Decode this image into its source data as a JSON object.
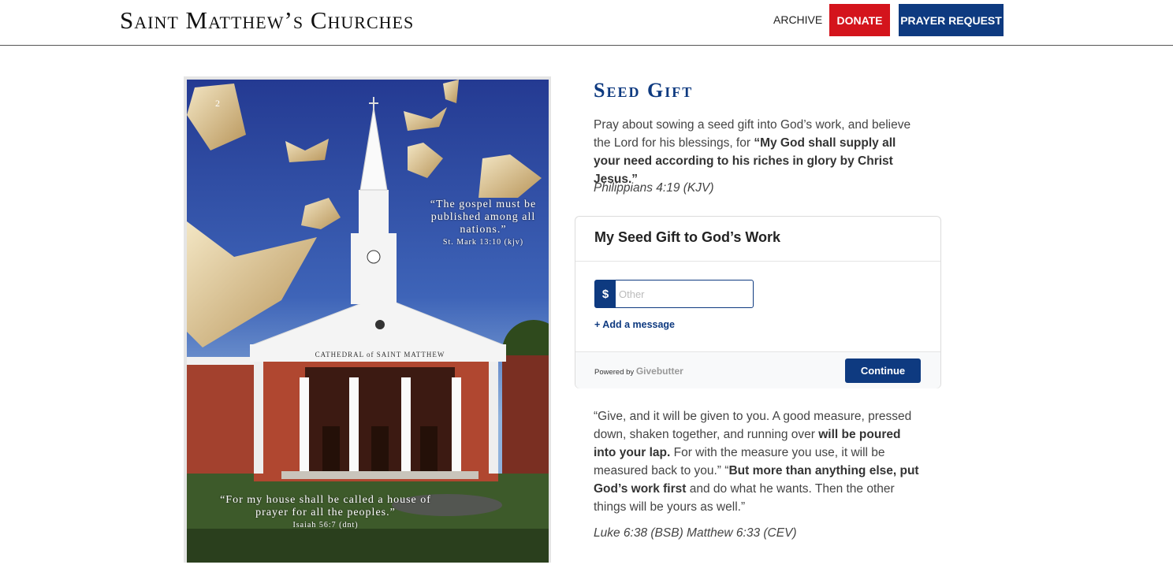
{
  "header": {
    "logo": "Saint Matthew’s Churches",
    "archive_label": "ARCHIVE",
    "donate_label": "DONATE",
    "prayer_label": "PRAYER REQUEST",
    "colors": {
      "donate": "#d4141c",
      "prayer": "#0e3a80"
    }
  },
  "poster": {
    "page_number": "2",
    "building_sign": "CATHEDRAL of SAINT MATTHEW",
    "quote1": "“The gospel must be published among all nations.”",
    "quote1_ref": "St. Mark 13:10 (kjv)",
    "quote2": "“For my house shall be called a house of prayer for all the peoples.”",
    "quote2_ref": "Isaiah 56:7 (dnt)"
  },
  "main": {
    "title": "Seed Gift",
    "intro_plain": "Pray about sowing a seed gift into God’s work, and believe the Lord for his blessings, for ",
    "intro_bold": "“My God shall supply all your need according to his riches in glory by Christ Jesus.”",
    "intro_cite": "Philippians 4:19 (KJV)",
    "quote_p1": "“Give, and it will be given to you. A good measure, pressed down, shaken together, and running over ",
    "quote_b1": "will be poured into your lap.",
    "quote_p2": " For with the measure you use, it will be measured back to you.” “",
    "quote_b2": "But more than anything else, put God’s work first",
    "quote_p3": " and do what he wants. Then the other things will be yours as well.”",
    "quote_cite": "Luke 6:38 (BSB) Matthew 6:33 (CEV)"
  },
  "widget": {
    "title": "My Seed Gift to God’s Work",
    "currency_symbol": "$",
    "amount_value": "",
    "amount_placeholder": "Other",
    "add_message": "+ Add a message",
    "powered_by": "Powered by",
    "provider": "Givebutter",
    "continue_label": "Continue"
  }
}
